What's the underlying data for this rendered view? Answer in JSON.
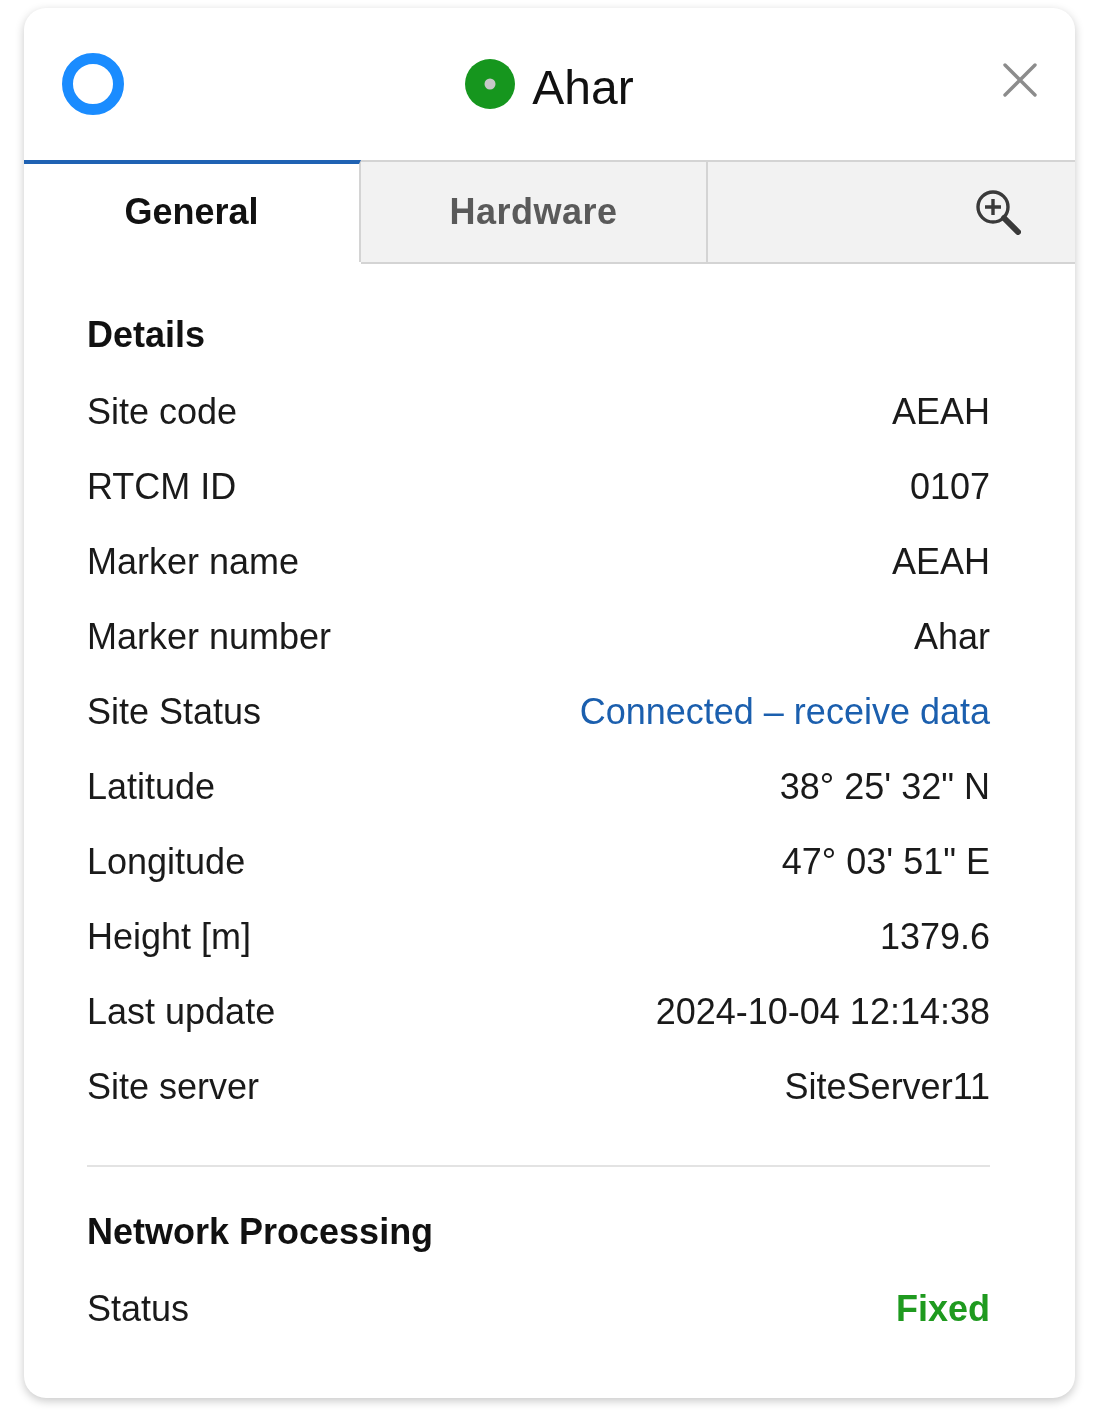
{
  "header": {
    "status": {
      "color": "#16961e"
    },
    "title": "Ahar"
  },
  "tabs": [
    {
      "label": "General",
      "selected": true
    },
    {
      "label": "Hardware",
      "selected": false
    }
  ],
  "sections": [
    {
      "title": "Details",
      "rows": [
        {
          "label": "Site code",
          "value": "AEAH",
          "kind": "text"
        },
        {
          "label": "RTCM ID",
          "value": "0107",
          "kind": "text"
        },
        {
          "label": "Marker name",
          "value": "AEAH",
          "kind": "text"
        },
        {
          "label": "Marker number",
          "value": "Ahar",
          "kind": "text"
        },
        {
          "label": "Site Status",
          "value": "Connected – receive data",
          "kind": "link"
        },
        {
          "label": "Latitude",
          "value": "38° 25' 32\" N",
          "kind": "text"
        },
        {
          "label": "Longitude",
          "value": "47° 03' 51\" E",
          "kind": "text"
        },
        {
          "label": "Height [m]",
          "value": "1379.6",
          "kind": "text"
        },
        {
          "label": "Last update",
          "value": "2024-10-04 12:14:38",
          "kind": "text"
        },
        {
          "label": "Site server",
          "value": "SiteServer11",
          "kind": "text"
        }
      ]
    },
    {
      "title": "Network Processing",
      "rows": [
        {
          "label": "Status",
          "value": "Fixed",
          "kind": "status",
          "color": "#1f9a1f"
        }
      ]
    }
  ]
}
